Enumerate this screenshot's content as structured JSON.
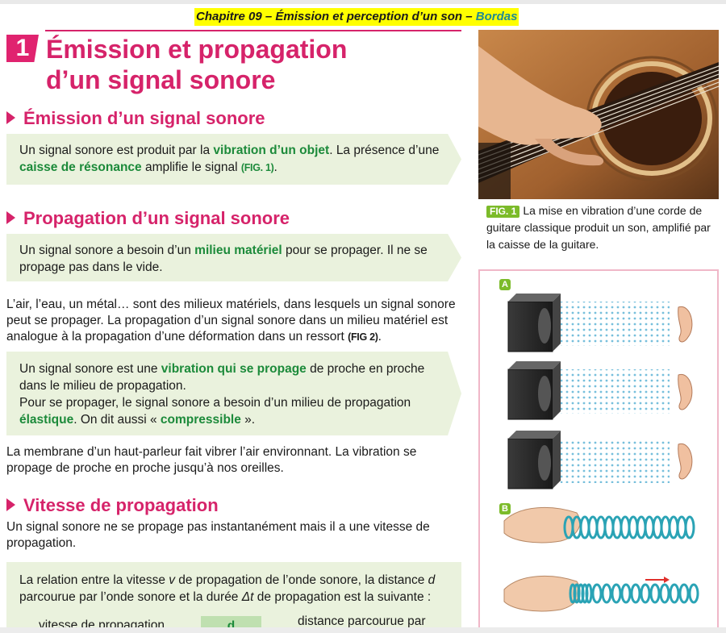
{
  "header": {
    "chapter": "Chapitre 09 – Émission et perception d’un son – ",
    "publisher": "Bordas"
  },
  "section_number": "1",
  "title": {
    "line1": "Émission et propagation",
    "line2": "d’un signal sonore"
  },
  "emission": {
    "heading": "Émission d’un signal sonore",
    "box": {
      "t1": "Un signal sonore est produit par la ",
      "h1": "vibration d’un objet",
      "t2": ". La présence d’une ",
      "h2": "caisse de résonance",
      "t3": " amplifie le signal ",
      "ref": "(FIG. 1)",
      "t4": "."
    }
  },
  "propagation": {
    "heading": "Propagation d’un signal sonore",
    "box1": {
      "t1": "Un signal sonore a besoin d’un ",
      "h1": "milieu matériel",
      "t2": " pour se propager. Il ne se propage pas dans le vide."
    },
    "para1": {
      "t1": "L’air, l’eau, un métal… sont des milieux matériels, dans lesquels un signal sonore peut se propager. La propagation d’un signal sonore dans un milieu matériel est analogue à la propagation d’une déformation dans un ressort ",
      "ref": "(FIG 2)",
      "t2": "."
    },
    "box2": {
      "t1": "Un signal sonore est une ",
      "h1": "vibration qui se propage",
      "t2": " de proche en proche dans le milieu de propagation.",
      "t3": "Pour se propager, le signal sonore a besoin d’un milieu de propagation ",
      "h2": "élastique",
      "t4": ". On dit aussi « ",
      "h3": "compressible",
      "t5": " »."
    },
    "para2": "La membrane d’un haut-parleur fait vibrer l’air environnant. La vibration se propage de proche en proche jusqu’à nos oreilles."
  },
  "vitesse": {
    "heading": "Vitesse de propagation",
    "para": "Un signal sonore ne se propage pas instantanément mais il a une vitesse de propagation.",
    "box": {
      "t1": "La relation entre la vitesse ",
      "v": "v",
      "t2": " de propagation de l’onde sonore, la distance ",
      "d": "d",
      "t3": " parcourue par l’onde sonore et la durée ",
      "dt": "Δt",
      "t4": " de propagation est la suivante :"
    },
    "formula": {
      "lhs": "vitesse de propagation",
      "numerator": "d",
      "rhs": "distance parcourue par"
    }
  },
  "fig1": {
    "tag": "FIG. 1",
    "caption": "La mise en vibration d’une corde de guitare classique produit un son, amplifié par la caisse de la guitare."
  },
  "fig2": {
    "label_a": "A",
    "label_b": "B"
  },
  "colors": {
    "magenta": "#d6236a",
    "green": "#1c8a3a",
    "box_bg": "#eaf2dd",
    "header_yellow": "#ffff00",
    "badge_green": "#7cbb2a"
  }
}
